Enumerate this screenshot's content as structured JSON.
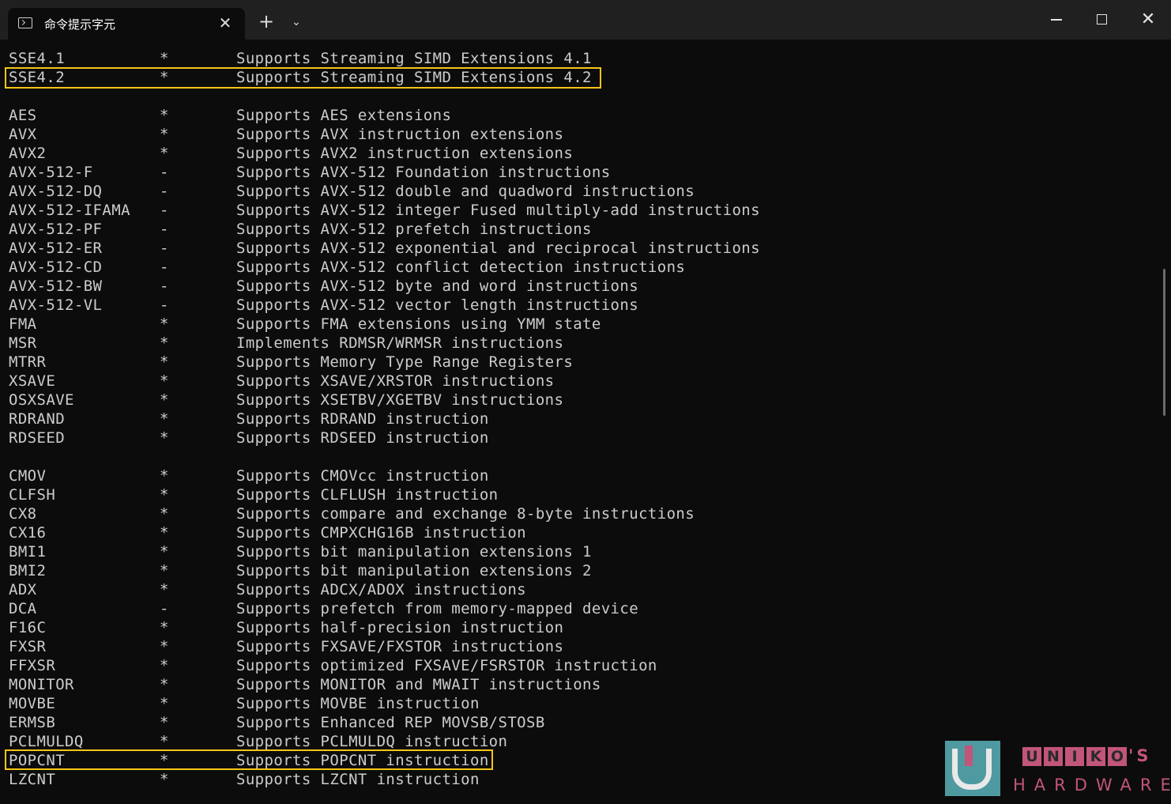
{
  "tab": {
    "title": "命令提示字元",
    "close": "✕"
  },
  "titlebar": {
    "new_tab": "+",
    "dropdown": "⌄",
    "close": "✕"
  },
  "icons": {
    "tab": "terminal-icon",
    "close": "close-icon",
    "new_tab": "plus-icon",
    "dropdown": "chevron-down-icon",
    "minimize": "minimize-icon",
    "maximize": "maximize-icon",
    "window_close": "close-icon"
  },
  "colors": {
    "highlight": "#f5c518",
    "text": "#cccccc",
    "background": "#0c0c0c",
    "watermark": "#c2557a"
  },
  "rows": [
    {
      "name": "SSE4.1",
      "flag": "*",
      "desc": "Supports Streaming SIMD Extensions 4.1"
    },
    {
      "name": "SSE4.2",
      "flag": "*",
      "desc": "Supports Streaming SIMD Extensions 4.2"
    },
    {
      "name": "",
      "flag": "",
      "desc": ""
    },
    {
      "name": "AES",
      "flag": "*",
      "desc": "Supports AES extensions"
    },
    {
      "name": "AVX",
      "flag": "*",
      "desc": "Supports AVX instruction extensions"
    },
    {
      "name": "AVX2",
      "flag": "*",
      "desc": "Supports AVX2 instruction extensions"
    },
    {
      "name": "AVX-512-F",
      "flag": "-",
      "desc": "Supports AVX-512 Foundation instructions"
    },
    {
      "name": "AVX-512-DQ",
      "flag": "-",
      "desc": "Supports AVX-512 double and quadword instructions"
    },
    {
      "name": "AVX-512-IFAMA",
      "flag": "-",
      "desc": "Supports AVX-512 integer Fused multiply-add instructions"
    },
    {
      "name": "AVX-512-PF",
      "flag": "-",
      "desc": "Supports AVX-512 prefetch instructions"
    },
    {
      "name": "AVX-512-ER",
      "flag": "-",
      "desc": "Supports AVX-512 exponential and reciprocal instructions"
    },
    {
      "name": "AVX-512-CD",
      "flag": "-",
      "desc": "Supports AVX-512 conflict detection instructions"
    },
    {
      "name": "AVX-512-BW",
      "flag": "-",
      "desc": "Supports AVX-512 byte and word instructions"
    },
    {
      "name": "AVX-512-VL",
      "flag": "-",
      "desc": "Supports AVX-512 vector length instructions"
    },
    {
      "name": "FMA",
      "flag": "*",
      "desc": "Supports FMA extensions using YMM state"
    },
    {
      "name": "MSR",
      "flag": "*",
      "desc": "Implements RDMSR/WRMSR instructions"
    },
    {
      "name": "MTRR",
      "flag": "*",
      "desc": "Supports Memory Type Range Registers"
    },
    {
      "name": "XSAVE",
      "flag": "*",
      "desc": "Supports XSAVE/XRSTOR instructions"
    },
    {
      "name": "OSXSAVE",
      "flag": "*",
      "desc": "Supports XSETBV/XGETBV instructions"
    },
    {
      "name": "RDRAND",
      "flag": "*",
      "desc": "Supports RDRAND instruction"
    },
    {
      "name": "RDSEED",
      "flag": "*",
      "desc": "Supports RDSEED instruction"
    },
    {
      "name": "",
      "flag": "",
      "desc": ""
    },
    {
      "name": "CMOV",
      "flag": "*",
      "desc": "Supports CMOVcc instruction"
    },
    {
      "name": "CLFSH",
      "flag": "*",
      "desc": "Supports CLFLUSH instruction"
    },
    {
      "name": "CX8",
      "flag": "*",
      "desc": "Supports compare and exchange 8-byte instructions"
    },
    {
      "name": "CX16",
      "flag": "*",
      "desc": "Supports CMPXCHG16B instruction"
    },
    {
      "name": "BMI1",
      "flag": "*",
      "desc": "Supports bit manipulation extensions 1"
    },
    {
      "name": "BMI2",
      "flag": "*",
      "desc": "Supports bit manipulation extensions 2"
    },
    {
      "name": "ADX",
      "flag": "*",
      "desc": "Supports ADCX/ADOX instructions"
    },
    {
      "name": "DCA",
      "flag": "-",
      "desc": "Supports prefetch from memory-mapped device"
    },
    {
      "name": "F16C",
      "flag": "*",
      "desc": "Supports half-precision instruction"
    },
    {
      "name": "FXSR",
      "flag": "*",
      "desc": "Supports FXSAVE/FXSTOR instructions"
    },
    {
      "name": "FFXSR",
      "flag": "*",
      "desc": "Supports optimized FXSAVE/FSRSTOR instruction"
    },
    {
      "name": "MONITOR",
      "flag": "*",
      "desc": "Supports MONITOR and MWAIT instructions"
    },
    {
      "name": "MOVBE",
      "flag": "*",
      "desc": "Supports MOVBE instruction"
    },
    {
      "name": "ERMSB",
      "flag": "*",
      "desc": "Supports Enhanced REP MOVSB/STOSB"
    },
    {
      "name": "PCLMULDQ",
      "flag": "*",
      "desc": "Supports PCLMULDQ instruction"
    },
    {
      "name": "POPCNT",
      "flag": "*",
      "desc": "Supports POPCNT instruction"
    },
    {
      "name": "LZCNT",
      "flag": "*",
      "desc": "Supports LZCNT instruction"
    }
  ],
  "watermark": {
    "letters": [
      "U",
      "N",
      "I",
      "K",
      "O"
    ],
    "suffix": "'S",
    "subtitle": "HARDWARE"
  }
}
